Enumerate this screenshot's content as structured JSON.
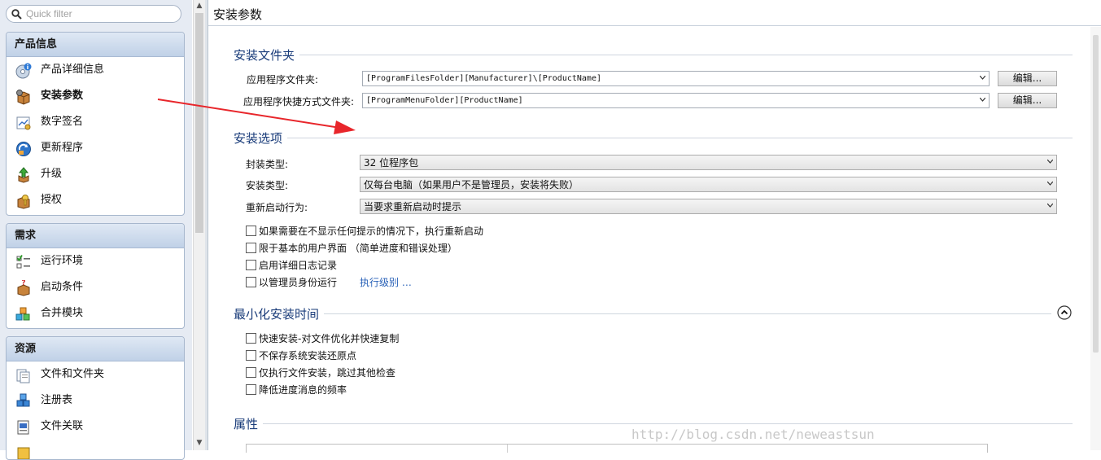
{
  "filter": {
    "placeholder": "Quick filter"
  },
  "sidebar": {
    "groups": [
      {
        "title": "产品信息",
        "items": [
          {
            "label": "产品详细信息",
            "icon": "cd-info-icon"
          },
          {
            "label": "安装参数",
            "icon": "package-gear-icon",
            "selected": true
          },
          {
            "label": "数字签名",
            "icon": "certificate-icon"
          },
          {
            "label": "更新程序",
            "icon": "update-icon"
          },
          {
            "label": "升级",
            "icon": "upgrade-icon"
          },
          {
            "label": "授权",
            "icon": "license-icon"
          }
        ]
      },
      {
        "title": "需求",
        "items": [
          {
            "label": "运行环境",
            "icon": "checklist-icon"
          },
          {
            "label": "启动条件",
            "icon": "launch-condition-icon"
          },
          {
            "label": "合并模块",
            "icon": "merge-module-icon"
          }
        ]
      },
      {
        "title": "资源",
        "items": [
          {
            "label": "文件和文件夹",
            "icon": "files-icon"
          },
          {
            "label": "注册表",
            "icon": "registry-icon"
          },
          {
            "label": "文件关联",
            "icon": "file-association-icon"
          },
          {
            "label": "",
            "icon": "partial-item-icon"
          }
        ]
      }
    ]
  },
  "page": {
    "title": "安装参数"
  },
  "sections": {
    "install_folder": {
      "title": "安装文件夹",
      "app_folder_label": "应用程序文件夹:",
      "app_folder_value": "[ProgramFilesFolder][Manufacturer]\\[ProductName]",
      "shortcut_folder_label": "应用程序快捷方式文件夹:",
      "shortcut_folder_value": "[ProgramMenuFolder][ProductName]",
      "edit_label": "编辑..."
    },
    "install_options": {
      "title": "安装选项",
      "package_type_label": "封装类型:",
      "package_type_value": "32 位程序包",
      "install_type_label": "安装类型:",
      "install_type_value": "仅每台电脑（如果用户不是管理员，安装将失败）",
      "reboot_label": "重新启动行为:",
      "reboot_value": "当要求重新启动时提示",
      "checkboxes": [
        "如果需要在不显示任何提示的情况下，执行重新启动",
        "限于基本的用户界面 （简单进度和错误处理）",
        "启用详细日志记录",
        "以管理员身份运行"
      ],
      "exec_level_link": "执行级别 …"
    },
    "minimize": {
      "title": "最小化安装时间",
      "checkboxes": [
        "快速安装-对文件优化并快速复制",
        "不保存系统安装还原点",
        "仅执行文件安装，跳过其他检查",
        "降低进度消息的频率"
      ]
    },
    "properties": {
      "title": "属性"
    }
  },
  "watermark": "http://blog.csdn.net/neweastsun",
  "colors": {
    "section_title": "#1a3c7a",
    "link": "#2a62b8",
    "arrow": "#e8262b"
  }
}
